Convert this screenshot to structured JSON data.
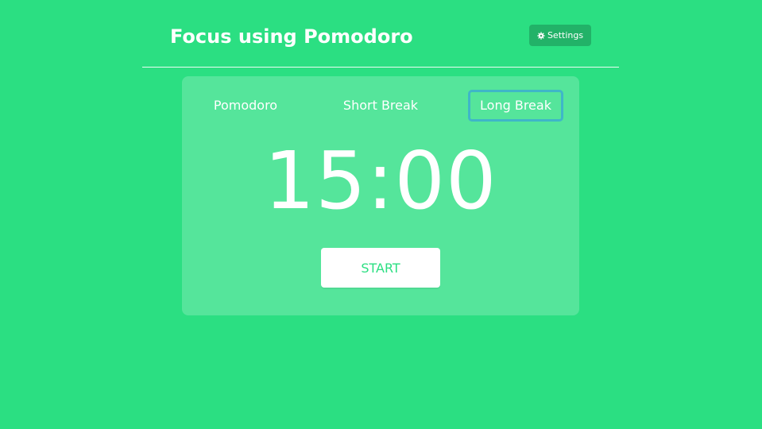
{
  "header": {
    "title": "Focus using Pomodoro",
    "settings_label": "Settings",
    "settings_icon": "gear-icon"
  },
  "modes": {
    "pomodoro": "Pomodoro",
    "short_break": "Short Break",
    "long_break": "Long Break",
    "selected": "Long Break"
  },
  "timer": {
    "display": "15:00"
  },
  "controls": {
    "start_label": "START"
  },
  "colors": {
    "background": "#2bdf82",
    "selected_tab_border": "#3fb6c8",
    "text": "#ffffff"
  }
}
